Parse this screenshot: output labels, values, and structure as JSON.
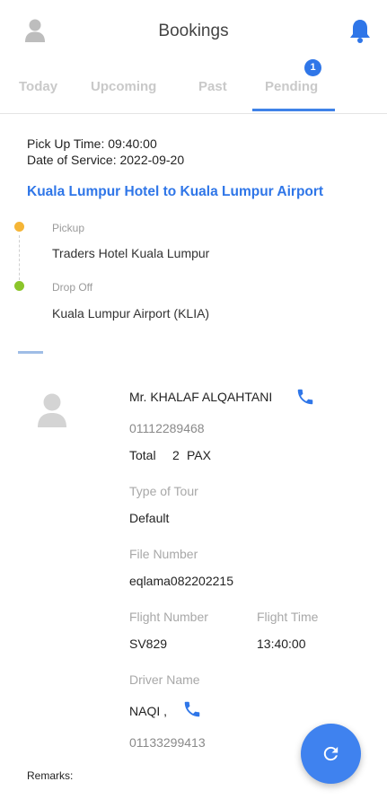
{
  "header": {
    "title": "Bookings"
  },
  "tabs": [
    {
      "label": "Today"
    },
    {
      "label": "Upcoming"
    },
    {
      "label": "Past"
    },
    {
      "label": "Pending",
      "badge": "1"
    }
  ],
  "booking": {
    "pickup_time_label": "Pick Up Time: 09:40:00",
    "service_date_label": "Date of Service: 2022-09-20",
    "route": "Kuala Lumpur Hotel to Kuala Lumpur Airport",
    "pickup_label": "Pickup",
    "pickup_place": "Traders Hotel Kuala Lumpur",
    "dropoff_label": "Drop Off",
    "dropoff_place": "Kuala Lumpur Airport (KLIA)"
  },
  "passenger": {
    "name": "Mr. KHALAF ALQAHTANI",
    "phone": "01112289468",
    "total": "Total",
    "pax_count": "2",
    "pax_unit": "PAX"
  },
  "details": {
    "tour_type_label": "Type of Tour",
    "tour_type_value": "Default",
    "file_number_label": "File Number",
    "file_number_value": "eqlama082202215",
    "flight_number_label": "Flight Number",
    "flight_number_value": "SV829",
    "flight_time_label": "Flight Time",
    "flight_time_value": "13:40:00",
    "driver_name_label": "Driver Name",
    "driver_name_value": "NAQI ,",
    "driver_phone": "01133299413",
    "remarks_label": "Remarks:"
  },
  "colors": {
    "accent": "#2f76e8",
    "pickup_dot": "#f5b536",
    "dropoff_dot": "#8bc52a"
  }
}
